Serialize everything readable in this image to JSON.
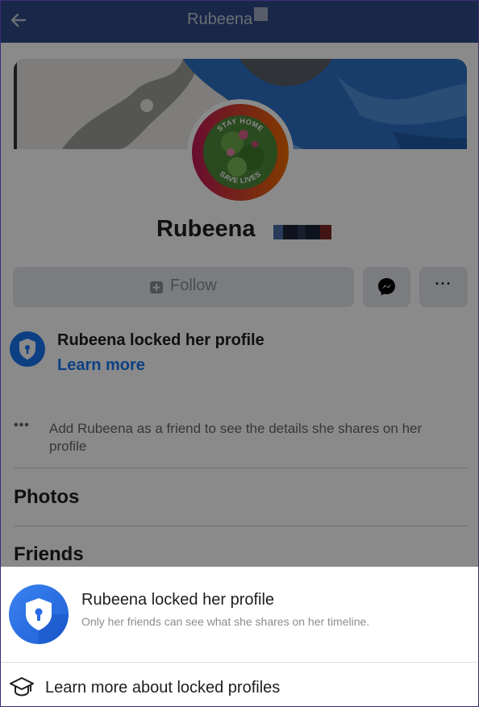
{
  "header": {
    "title": "Rubeena",
    "back_icon": "arrow-left-icon"
  },
  "profile": {
    "name": "Rubeena",
    "avatar_frame_top": "STAY HOME",
    "avatar_frame_bottom": "SAVE LIVES",
    "follow_label": "Follow",
    "messenger_icon": "messenger-icon",
    "more_label": "···"
  },
  "lock_notice": {
    "title": "Rubeena locked her profile",
    "link": "Learn more",
    "info_dots": "•••",
    "info": "Add Rubeena as a friend to see the details she shares on her profile"
  },
  "sections": {
    "photos": "Photos",
    "friends": "Friends"
  },
  "sheet": {
    "title": "Rubeena locked her profile",
    "subtitle": "Only her friends can see what she shares on her timeline.",
    "link": "Learn more about locked profiles"
  },
  "colors": {
    "accent": "#1877f2",
    "topbar": "#2f4a86"
  }
}
